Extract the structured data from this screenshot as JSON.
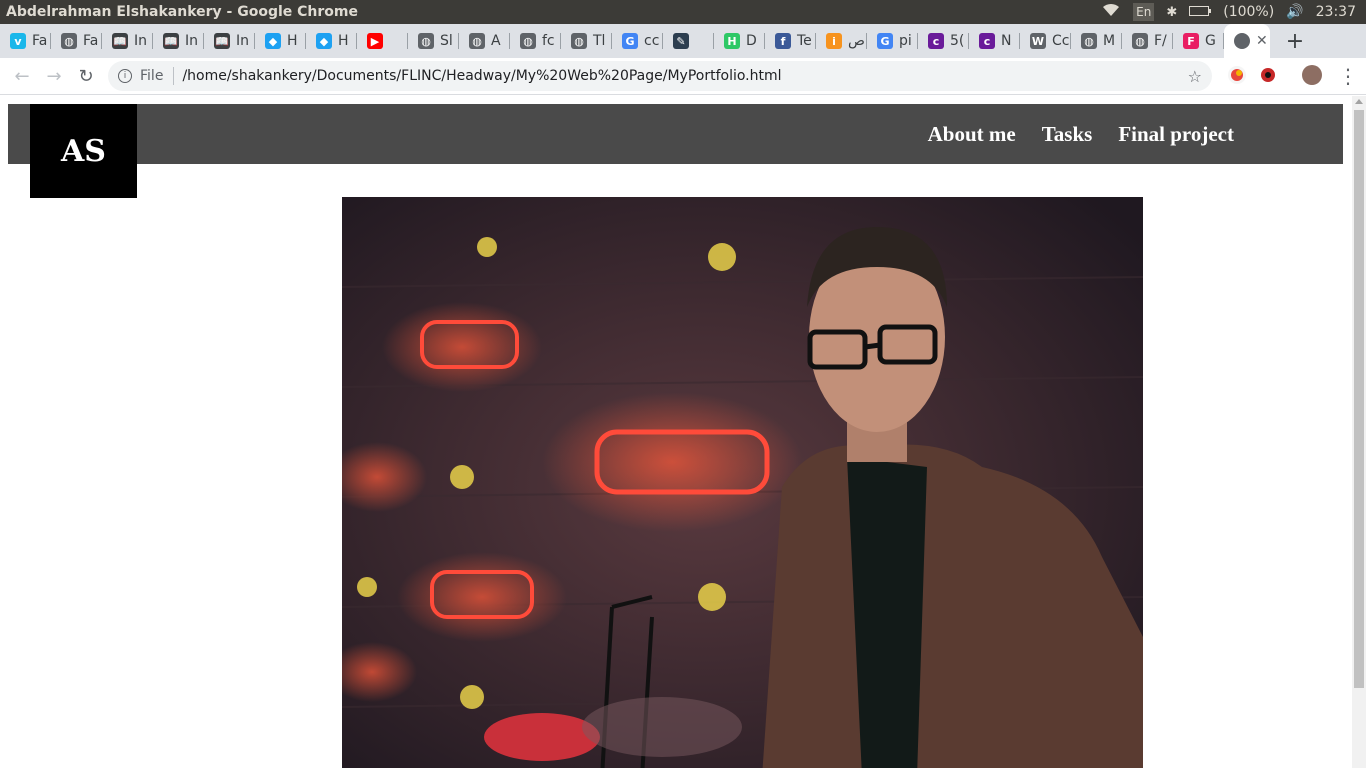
{
  "os": {
    "window_title": "Abdelrahman Elshakankery - Google Chrome",
    "lang": "En",
    "battery": "(100%)",
    "time": "23:37"
  },
  "tabs": [
    {
      "label": "Fa",
      "icon": "vimeo-icon",
      "color": "#1ab7ea",
      "glyph": "v"
    },
    {
      "label": "Fa",
      "icon": "globe-icon",
      "color": "#5f6368",
      "glyph": "◍"
    },
    {
      "label": "In",
      "icon": "book-icon",
      "color": "#3c4043",
      "glyph": "📖"
    },
    {
      "label": "In",
      "icon": "book-icon",
      "color": "#3c4043",
      "glyph": "📖"
    },
    {
      "label": "In",
      "icon": "book-icon",
      "color": "#3c4043",
      "glyph": "📖"
    },
    {
      "label": "H",
      "icon": "bird-icon",
      "color": "#1da1f2",
      "glyph": "◆"
    },
    {
      "label": "H",
      "icon": "bird-icon",
      "color": "#1da1f2",
      "glyph": "◆"
    },
    {
      "label": "",
      "icon": "youtube-icon",
      "color": "#ff0000",
      "glyph": "▶"
    },
    {
      "label": "Sl",
      "icon": "globe-icon",
      "color": "#5f6368",
      "glyph": "◍"
    },
    {
      "label": "A",
      "icon": "globe-icon",
      "color": "#5f6368",
      "glyph": "◍"
    },
    {
      "label": "fc",
      "icon": "globe-icon",
      "color": "#5f6368",
      "glyph": "◍"
    },
    {
      "label": "Tl",
      "icon": "globe-icon",
      "color": "#5f6368",
      "glyph": "◍"
    },
    {
      "label": "cc",
      "icon": "google-icon",
      "color": "#4285f4",
      "glyph": "G"
    },
    {
      "label": "",
      "icon": "pen-icon",
      "color": "#2d3e50",
      "glyph": "✎"
    },
    {
      "label": "D",
      "icon": "hackerrank-icon",
      "color": "#2ec866",
      "glyph": "H"
    },
    {
      "label": "Te",
      "icon": "facebook-icon",
      "color": "#3b5998",
      "glyph": "f"
    },
    {
      "label": "ص",
      "icon": "info-icon",
      "color": "#f7931e",
      "glyph": "i"
    },
    {
      "label": "pi",
      "icon": "google-icon",
      "color": "#4285f4",
      "glyph": "G"
    },
    {
      "label": "5(",
      "icon": "coursera-icon",
      "color": "#6a1b9a",
      "glyph": "c"
    },
    {
      "label": "N",
      "icon": "coursera-icon",
      "color": "#6a1b9a",
      "glyph": "c"
    },
    {
      "label": "Cc",
      "icon": "wordpress-icon",
      "color": "#5f6368",
      "glyph": "W"
    },
    {
      "label": "M",
      "icon": "globe-icon",
      "color": "#5f6368",
      "glyph": "◍"
    },
    {
      "label": "F/",
      "icon": "globe-icon",
      "color": "#5f6368",
      "glyph": "◍"
    },
    {
      "label": "G",
      "icon": "flinc-icon",
      "color": "#e91e63",
      "glyph": "F"
    }
  ],
  "active_tab": {
    "icon": "globe-icon",
    "close": "✕"
  },
  "newtab": "+",
  "toolbar": {
    "back": "←",
    "forward": "→",
    "reload": "↻",
    "file_label": "File",
    "url": "/home/shakankery/Documents/FLINC/Headway/My%20Web%20Page/MyPortfolio.html",
    "star": "☆",
    "menu": "⋮"
  },
  "site": {
    "logo_text": "AS",
    "nav": [
      "About me",
      "Tasks",
      "Final project"
    ]
  }
}
